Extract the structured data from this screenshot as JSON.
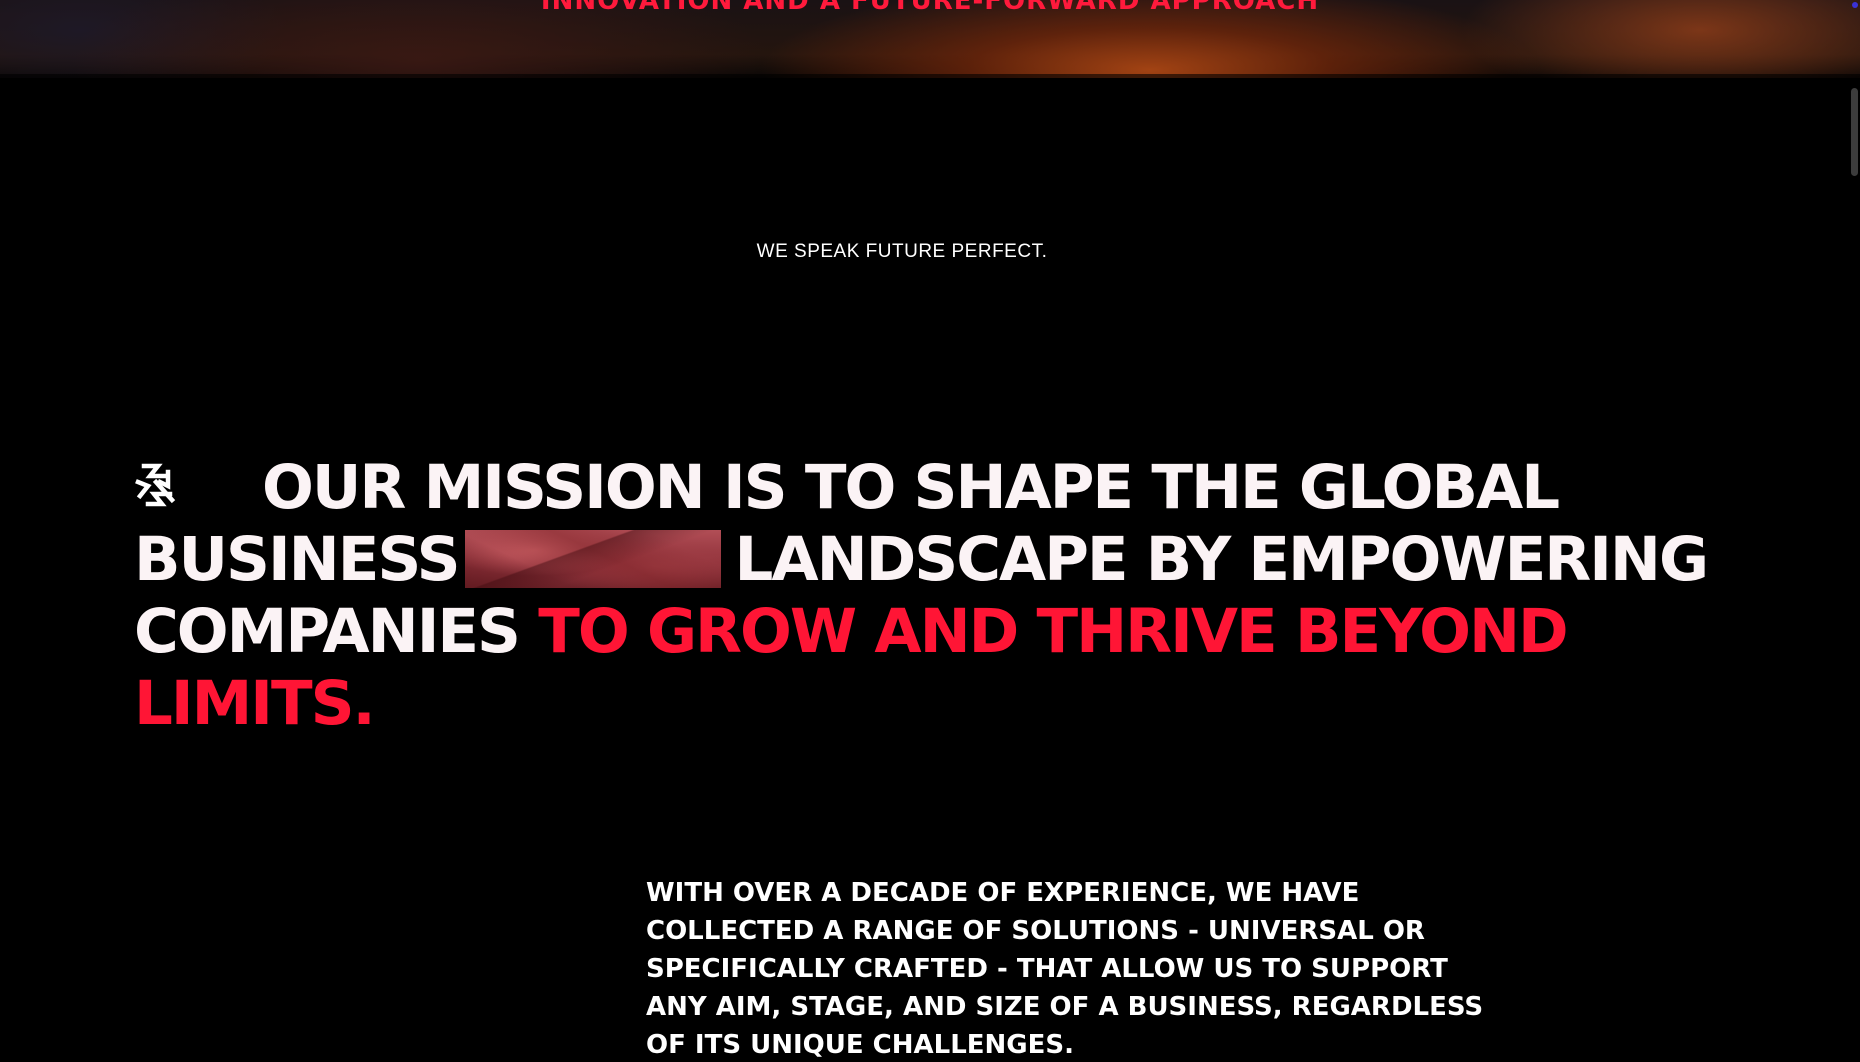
{
  "hero": {
    "tagline": "INNOVATION AND A FUTURE-FORWARD APPROACH"
  },
  "about": {
    "eyebrow": "WE SPEAK FUTURE PERFECT.",
    "mission": {
      "icon": "brand-star-icon",
      "line1": "OUR MISSION IS TO SHAPE THE GLOBAL",
      "line2_before": "BUSINESS",
      "line2_after": "LANDSCAPE BY EMPOWERING",
      "line3_white": "COMPANIES",
      "line3_accent": "TO GROW AND THRIVE BEYOND",
      "line4_accent": "LIMITS.",
      "accent_color": "#ff1535"
    },
    "intro": "WITH OVER A DECADE OF EXPERIENCE, WE HAVE COLLECTED A RANGE OF SOLUTIONS - UNIVERSAL OR SPECIFICALLY CRAFTED - THAT ALLOW US TO SUPPORT ANY AIM, STAGE, AND SIZE OF A BUSINESS, REGARDLESS OF ITS UNIQUE CHALLENGES."
  }
}
